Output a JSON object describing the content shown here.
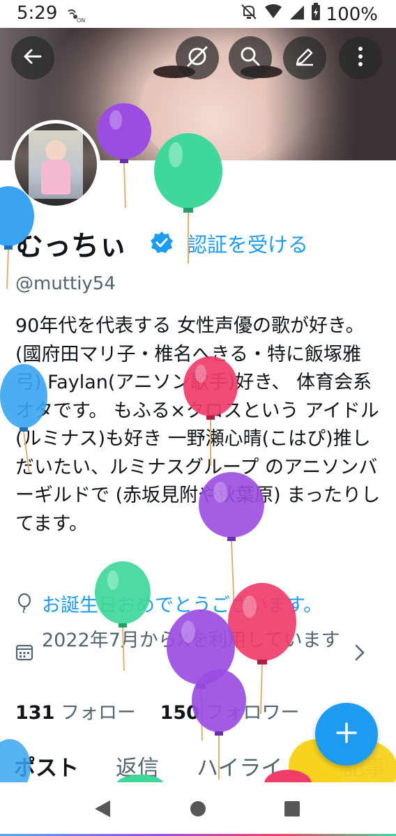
{
  "status_bar": {
    "time": "5:29",
    "nfc_label": "ON",
    "battery": "100%"
  },
  "header": {
    "back_icon": "arrow-left-icon",
    "grok_icon": "grok-icon",
    "search_icon": "search-icon",
    "edit_icon": "pencil-icon",
    "more_icon": "more-vertical-icon"
  },
  "profile": {
    "display_name": "むっちぃ",
    "verify_link": "認証を受ける",
    "handle": "@muttiy54",
    "bio": "90年代を代表する 女性声優の歌が好き。 (國府田マリ子・椎名へきる・特に飯塚雅弓) Faylan(アニソン歌手)好き、 体育会系オタです。 もふる×クロスという アイドル(ルミナス)も好き 一野瀬心晴(こはぴ)推し だいたい、ルミナスグループ のアニソンバーギルドで (赤坂見附や秋葉原) まったりしてます。",
    "birthday_text": "お誕生日おめでとうございます。",
    "joined_text": "2022年7月からXを利用しています",
    "following_count": "131",
    "following_label": "フォロー",
    "followers_count": "150",
    "followers_label": "フォロワー"
  },
  "tabs": [
    "ポスト",
    "返信",
    "ハイライト",
    "記事"
  ],
  "colors": {
    "accent": "#1d9bf0",
    "text_primary": "#0f1419",
    "text_secondary": "#536471"
  },
  "decorations": [
    "balloon-purple",
    "balloon-green",
    "balloon-blue",
    "balloon-red",
    "balloon-yellow"
  ]
}
